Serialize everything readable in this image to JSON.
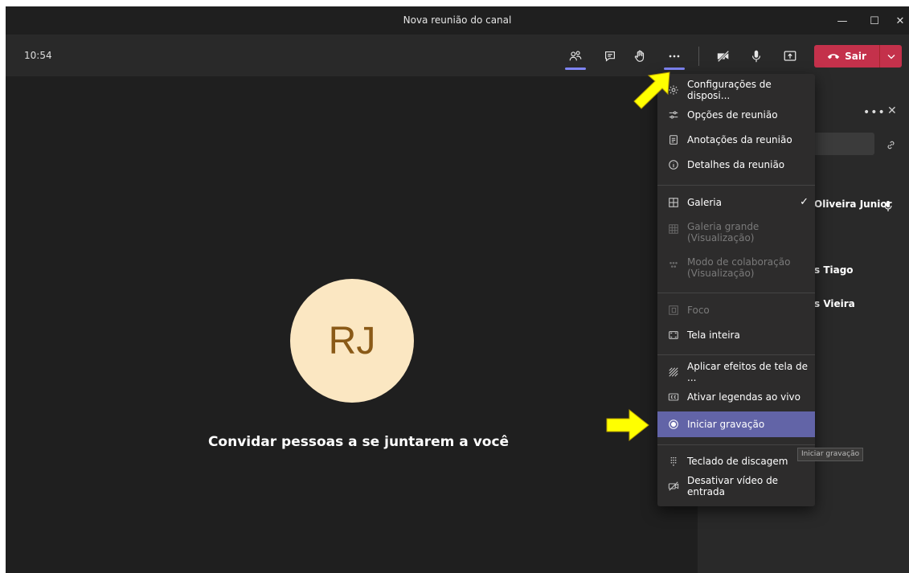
{
  "window": {
    "title": "Nova reunião do canal",
    "min_glyph": "—",
    "max_glyph": "☐",
    "close_glyph": "✕"
  },
  "toolbar": {
    "time": "10:54",
    "leave_label": "Sair",
    "leave_color": "#c4314b",
    "accent_color": "#7f85f5"
  },
  "stage": {
    "avatar_initials": "RJ",
    "avatar_bg": "#fbe7c2",
    "invite_text": "Convidar pessoas a se juntarem a você"
  },
  "panel": {
    "participants": [
      {
        "name": "Oliveira Junior"
      },
      {
        "name": "s Tiago"
      },
      {
        "name": "s Vieira"
      }
    ]
  },
  "menu": {
    "items": [
      {
        "label": "Configurações de disposi...",
        "icon": "gear-icon"
      },
      {
        "label": "Opções de reunião",
        "icon": "sliders-icon"
      },
      {
        "label": "Anotações da reunião",
        "icon": "notes-icon"
      },
      {
        "label": "Detalhes da reunião",
        "icon": "info-icon"
      },
      {
        "label": "Galeria",
        "icon": "gallery-icon",
        "checked": true
      },
      {
        "label": "Galeria grande",
        "sublabel": "(Visualização)",
        "icon": "large-gallery-icon",
        "disabled": true
      },
      {
        "label": "Modo de colaboração",
        "sublabel": "(Visualização)",
        "icon": "together-mode-icon",
        "disabled": true
      },
      {
        "label": "Foco",
        "icon": "focus-icon",
        "disabled": true
      },
      {
        "label": "Tela inteira",
        "icon": "fullscreen-icon"
      },
      {
        "label": "Aplicar efeitos de tela de ...",
        "icon": "background-effects-icon"
      },
      {
        "label": "Ativar legendas ao vivo",
        "icon": "captions-icon"
      },
      {
        "label": "Iniciar gravação",
        "icon": "record-icon",
        "selected": true
      },
      {
        "label": "Teclado de discagem",
        "icon": "dialpad-icon"
      },
      {
        "label": "Desativar vídeo de entrada",
        "icon": "video-off-icon"
      }
    ],
    "selected_color": "#6264a7"
  },
  "tooltip": {
    "text": "Iniciar gravação"
  },
  "annotation_color": "#ffff00"
}
